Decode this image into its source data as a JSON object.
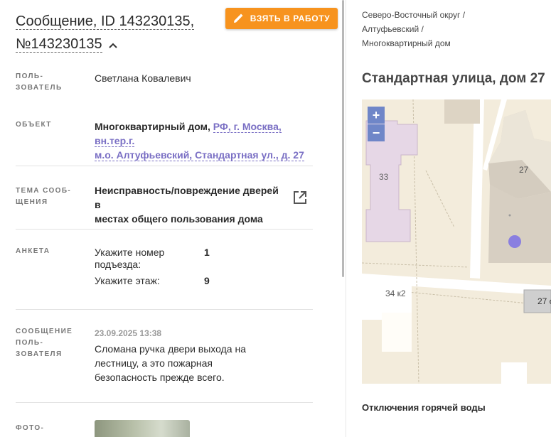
{
  "message": {
    "title": "Сообщение, ID 143230135, №143230135",
    "take_button": "ВЗЯТЬ В РАБОТУ",
    "user_label_1": "ПОЛЬ-",
    "user_label_2": "ЗОВАТЕЛЬ",
    "user_name": "Светлана Ковалевич",
    "object_label": "ОБЪЕКТ",
    "object_type": "Многоквартирный дом,",
    "object_address_1": "РФ, г. Москва, вн.тер.г.",
    "object_address_2": "м.о. Алтуфьевский, Стандартная ул., д. 27",
    "topic_label_1": "ТЕМА СООБ-",
    "topic_label_2": "ЩЕНИЯ",
    "topic_1": "Неисправность/повреждение дверей в",
    "topic_2": "местах общего пользования дома",
    "survey_label": "АНКЕТА",
    "survey": [
      {
        "question_1": "Укажите номер",
        "question_2": "подъезда:",
        "answer": "1"
      },
      {
        "question_1": "Укажите этаж:",
        "question_2": "",
        "answer": "9"
      }
    ],
    "user_msg_label_1": "СООБЩЕНИЕ",
    "user_msg_label_2": "ПОЛЬ-",
    "user_msg_label_3": "ЗОВАТЕЛЯ",
    "user_msg_date": "23.09.2025 13:38",
    "user_msg_1": "Сломана ручка двери выхода на",
    "user_msg_2": "лестницу, а это пожарная",
    "user_msg_3": "безопасность прежде всего.",
    "photo_label": "ФОТО-"
  },
  "location": {
    "breadcrumb": [
      "Северо-Восточный округ /",
      "Алтуфьевский /",
      "Многоквартирный дом"
    ],
    "title": "Стандартная улица, дом 27",
    "zoom_in": "+",
    "zoom_out": "−",
    "map_labels": {
      "b33": "33",
      "b27": "27",
      "b34k2": "34 к2",
      "b27b": "27 с"
    },
    "section": "Отключения горячей воды"
  },
  "colors": {
    "accent": "#f7931e",
    "link": "#7a6fc4",
    "marker": "#8a7fe0",
    "zoom": "#6f86c8"
  }
}
